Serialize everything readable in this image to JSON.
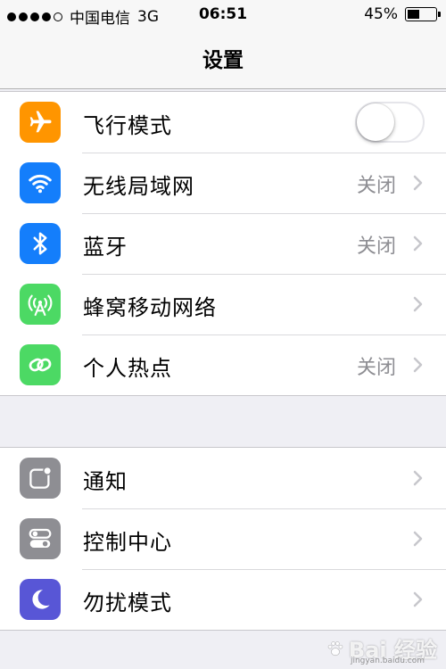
{
  "status_bar": {
    "carrier": "中国电信",
    "network": "3G",
    "time": "06:51",
    "battery_percent": "45%",
    "battery_level": 0.45,
    "signal_bars": 5,
    "signal_filled": 4
  },
  "nav": {
    "title": "设置"
  },
  "group1": [
    {
      "label": "飞行模式",
      "icon": "airplane-icon",
      "color": "#ff9500",
      "toggle": true,
      "toggle_on": false
    },
    {
      "label": "无线局域网",
      "icon": "wifi-icon",
      "color": "#147efb",
      "value": "关闭"
    },
    {
      "label": "蓝牙",
      "icon": "bluetooth-icon",
      "color": "#147efb",
      "value": "关闭"
    },
    {
      "label": "蜂窝移动网络",
      "icon": "cellular-icon",
      "color": "#4cd964"
    },
    {
      "label": "个人热点",
      "icon": "hotspot-icon",
      "color": "#4cd964",
      "value": "关闭"
    }
  ],
  "group2": [
    {
      "label": "通知",
      "icon": "notifications-icon",
      "color": "#8e8e93"
    },
    {
      "label": "控制中心",
      "icon": "control-center-icon",
      "color": "#8e8e93"
    },
    {
      "label": "勿扰模式",
      "icon": "moon-icon",
      "color": "#5856d6"
    }
  ],
  "watermark": {
    "text": "Bai 经验",
    "subtext": "jingyan.baidu.com"
  }
}
